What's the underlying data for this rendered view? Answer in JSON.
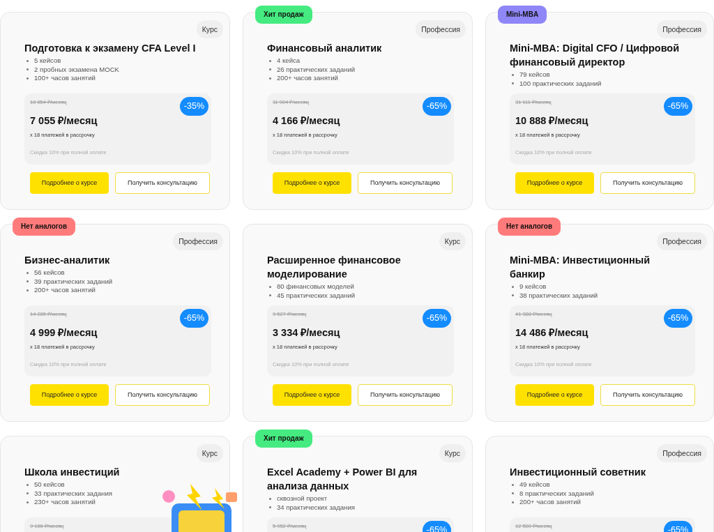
{
  "cards": [
    {
      "type": "Курс",
      "title": "Подготовка к экзамену CFA Level I",
      "features": [
        "5 кейсов",
        "2 пробных экзамена MOCK",
        "100+ часов занятий"
      ],
      "old_price": "10 854 ₽/месяц",
      "price": "7 055 ₽/месяц",
      "installments": "x 18 платежей в рассрочку",
      "note": "Скидка 10% при полной оплате",
      "discount": "-35%",
      "buttons": [
        "Подробнее о курсе",
        "Получить консультацию"
      ]
    },
    {
      "badge": {
        "text": "Хит продаж",
        "color": "#45eb80"
      },
      "type": "Профессия",
      "title": "Финансовый аналитик",
      "features": [
        "4 кейса",
        "26 практических заданий",
        "200+ часов занятий"
      ],
      "old_price": "11 904 ₽/месяц",
      "price": "4 166 ₽/месяц",
      "installments": "x 18 платежей в рассрочку",
      "note": "Скидка 10% при полной оплате",
      "discount": "-65%",
      "buttons": [
        "Подробнее о курсе",
        "Получить консультацию"
      ]
    },
    {
      "badge": {
        "text": "Mini-MBA",
        "color": "#8f86f7"
      },
      "type": "Профессия",
      "title": "Mini-MBA: Digital CFO / Цифровой финансовый директор",
      "features": [
        "79 кейсов",
        "100 практических заданий"
      ],
      "old_price": "31 111 ₽/месяц",
      "price": "10 888 ₽/месяц",
      "installments": "x 18 платежей в рассрочку",
      "note": "Скидка 10% при полной оплате",
      "discount": "-65%",
      "buttons": [
        "Подробнее о курсе",
        "Получить консультацию"
      ]
    },
    {
      "badge": {
        "text": "Нет аналогов",
        "color": "#ff7a7a"
      },
      "type": "Профессия",
      "title": "Бизнес-аналитик",
      "features": [
        "56 кейсов",
        "39 практических заданий",
        "200+ часов занятий"
      ],
      "old_price": "14 285 ₽/месяц",
      "price": "4 999 ₽/месяц",
      "installments": "x 18 платежей в рассрочку",
      "note": "Скидка 10% при полной оплате",
      "discount": "-65%",
      "buttons": [
        "Подробнее о курсе",
        "Получить консультацию"
      ]
    },
    {
      "type": "Курс",
      "title": "Расширенное финансовое моделирование",
      "features": [
        "80 финансовых моделей",
        "45 практических заданий"
      ],
      "old_price": "9 527 ₽/месяц",
      "price": "3 334 ₽/месяц",
      "installments": "x 18 платежей в рассрочку",
      "note": "Скидка 10% при полной оплате",
      "discount": "-65%",
      "buttons": [
        "Подробнее о курсе",
        "Получить консультацию"
      ]
    },
    {
      "badge": {
        "text": "Нет аналогов",
        "color": "#ff7a7a"
      },
      "type": "Профессия",
      "title": "Mini-MBA: Инвестиционный банкир",
      "features": [
        "9 кейсов",
        "38 практических заданий"
      ],
      "old_price": "41 388 ₽/месяц",
      "price": "14 486 ₽/месяц",
      "installments": "x 18 платежей в рассрочку",
      "note": "Скидка 10% при полной оплате",
      "discount": "-65%",
      "buttons": [
        "Подробнее о курсе",
        "Получить консультацию"
      ]
    },
    {
      "type": "Курс",
      "title": "Школа инвестиций",
      "features": [
        "50 кейсов",
        "33 практических задания",
        "230+ часов занятий"
      ],
      "old_price": "9 166 ₽/месяц"
    },
    {
      "badge": {
        "text": "Хит продаж",
        "color": "#45eb80"
      },
      "type": "Курс",
      "title": "Excel Academy + Power BI для анализа данных",
      "features": [
        "сквозной проект",
        "34 практических задания"
      ],
      "old_price": "5 952 ₽/месяц",
      "discount": "-65%"
    },
    {
      "type": "Профессия",
      "title": "Инвестиционный советник",
      "features": [
        "49 кейсов",
        "8 практических заданий",
        "200+ часов занятий"
      ],
      "old_price": "12 500 ₽/месяц",
      "discount": "-65%"
    }
  ]
}
